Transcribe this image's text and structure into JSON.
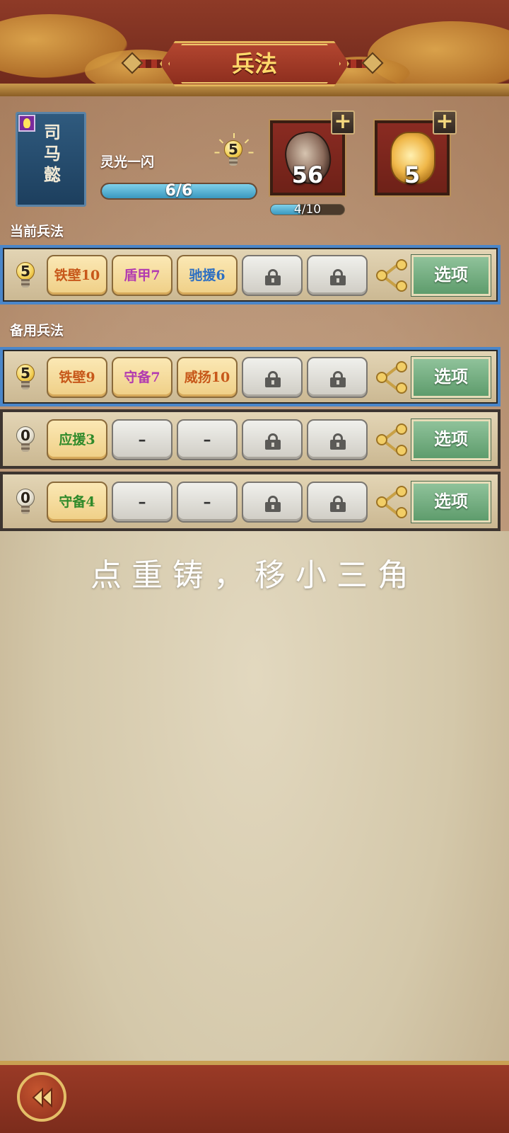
{
  "header": {
    "title": "兵法"
  },
  "hero": {
    "name": "司马懿",
    "skill_name": "灵光一闪",
    "skill_level": "5",
    "progress_text": "6/6",
    "progress_fraction": 1.0
  },
  "items": [
    {
      "name": "shell-item",
      "count": "56",
      "progress_text": "4/10",
      "progress_fraction": 0.4
    },
    {
      "name": "gold-token-item",
      "count": "5"
    }
  ],
  "sections": {
    "current_label": "当前兵法",
    "backup_label": "备用兵法"
  },
  "rows": [
    {
      "bulb": "5",
      "bulb_on": true,
      "selected": true,
      "tags": [
        {
          "type": "skill",
          "label": "铁壁10",
          "color": "#c7581a"
        },
        {
          "type": "skill",
          "label": "盾甲7",
          "color": "#b23bb0"
        },
        {
          "type": "skill",
          "label": "驰援6",
          "color": "#2d6fc2"
        },
        {
          "type": "locked"
        },
        {
          "type": "locked"
        }
      ],
      "options_label": "选项"
    },
    {
      "bulb": "5",
      "bulb_on": true,
      "selected": true,
      "tags": [
        {
          "type": "skill",
          "label": "铁壁9",
          "color": "#c7581a"
        },
        {
          "type": "skill",
          "label": "守备7",
          "color": "#b23bb0"
        },
        {
          "type": "skill",
          "label": "威扬10",
          "color": "#c7581a"
        },
        {
          "type": "locked"
        },
        {
          "type": "locked"
        }
      ],
      "options_label": "选项"
    },
    {
      "bulb": "0",
      "bulb_on": false,
      "selected": false,
      "tags": [
        {
          "type": "skill",
          "label": "应援3",
          "color": "#2f8a2a"
        },
        {
          "type": "empty",
          "label": "–"
        },
        {
          "type": "empty",
          "label": "–"
        },
        {
          "type": "locked"
        },
        {
          "type": "locked"
        }
      ],
      "options_label": "选项"
    },
    {
      "bulb": "0",
      "bulb_on": false,
      "selected": false,
      "tags": [
        {
          "type": "skill",
          "label": "守备4",
          "color": "#2f8a2a"
        },
        {
          "type": "empty",
          "label": "–"
        },
        {
          "type": "empty",
          "label": "–"
        },
        {
          "type": "locked"
        },
        {
          "type": "locked"
        }
      ],
      "options_label": "选项"
    }
  ],
  "caption": "点重铸，移小三角",
  "icons": {
    "bulb": "lightbulb-icon",
    "lock": "lock-icon",
    "share": "share-icon",
    "plus": "plus-icon",
    "back": "back-arrow-icon"
  }
}
